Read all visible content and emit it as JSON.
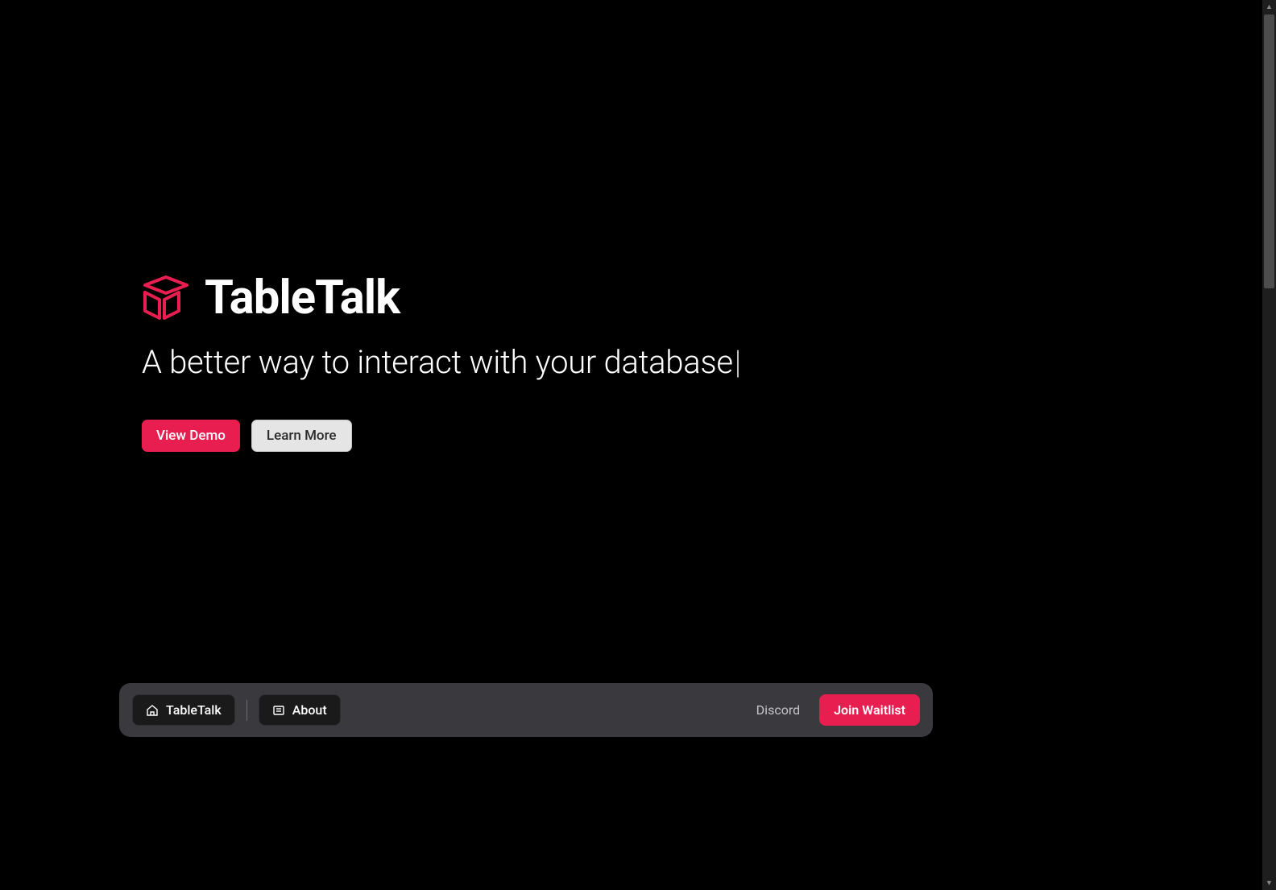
{
  "brand": {
    "name": "TableTalk",
    "logo_color": "#e91e50"
  },
  "hero": {
    "tagline": "A better way to interact with your database",
    "cursor": "|",
    "cta_primary": "View Demo",
    "cta_secondary": "Learn More"
  },
  "nav": {
    "items": [
      {
        "label": "TableTalk",
        "icon": "home"
      },
      {
        "label": "About",
        "icon": "news"
      }
    ],
    "link": "Discord",
    "cta": "Join Waitlist"
  }
}
